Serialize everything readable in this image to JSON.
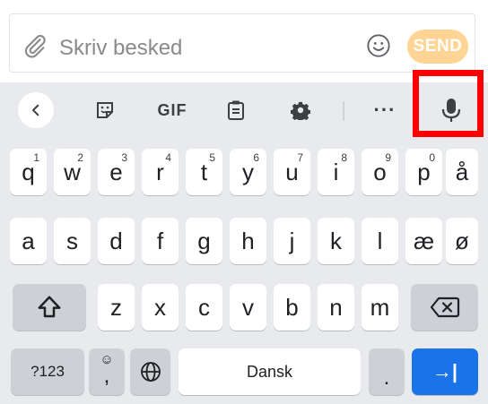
{
  "compose": {
    "placeholder": "Skriv besked",
    "send_label": "SEND",
    "send_color": "#ffd494"
  },
  "toolbar": {
    "back_icon": "chevron-left-icon",
    "sticker_icon": "sticker-icon",
    "gif_label": "GIF",
    "clipboard_icon": "clipboard-icon",
    "settings_icon": "gear-icon",
    "more_label": "···",
    "mic_icon": "microphone-icon",
    "highlight_color": "#ff0000"
  },
  "rows": {
    "row1": [
      {
        "label": "q",
        "hint": "1"
      },
      {
        "label": "w",
        "hint": "2"
      },
      {
        "label": "e",
        "hint": "3"
      },
      {
        "label": "r",
        "hint": "4"
      },
      {
        "label": "t",
        "hint": "5"
      },
      {
        "label": "y",
        "hint": "6"
      },
      {
        "label": "u",
        "hint": "7"
      },
      {
        "label": "i",
        "hint": "8"
      },
      {
        "label": "o",
        "hint": "9"
      },
      {
        "label": "p",
        "hint": "0"
      },
      {
        "label": "å",
        "hint": ""
      }
    ],
    "row2": [
      "a",
      "s",
      "d",
      "f",
      "g",
      "h",
      "j",
      "k",
      "l",
      "æ",
      "ø"
    ],
    "row3": [
      "z",
      "x",
      "c",
      "v",
      "b",
      "n",
      "m"
    ],
    "bottom": {
      "symbols_label": "?123",
      "emoji_hint": "☺",
      "comma_label": ",",
      "space_label": "Dansk",
      "period_label": ".",
      "enter_label": "→|",
      "enter_color": "#1a73e8"
    }
  }
}
